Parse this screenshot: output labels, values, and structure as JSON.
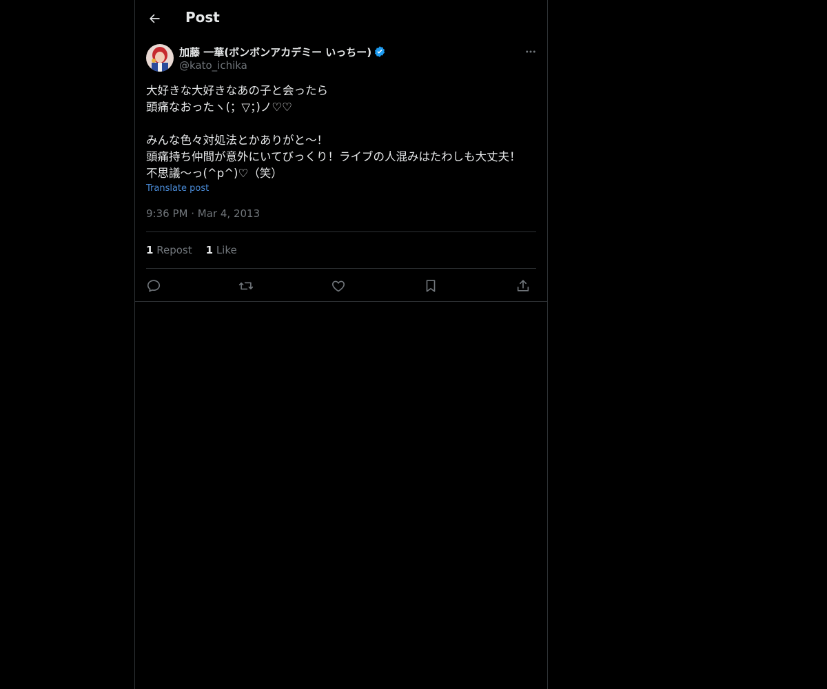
{
  "header": {
    "title": "Post",
    "back_icon": "arrow-left-icon"
  },
  "post": {
    "author": {
      "display_name": "加藤 一華(ボンボンアカデミー いっちー)",
      "handle": "@kato_ichika",
      "verified": true,
      "avatar_icon": "avatar"
    },
    "more_icon": "more-horizontal-icon",
    "text_lines": [
      "大好きな大好きなあの子と会ったら",
      "頭痛なおったヽ(；▽；)ノ♡♡",
      "",
      "みんな色々対処法とかありがと〜！",
      "頭痛持ち仲間が意外にいてびっくり！ライブの人混みはたわしも大丈夫！",
      "不思議〜っ(^p^)♡（笑）"
    ],
    "translate_label": "Translate post",
    "time": "9:36 PM",
    "separator": "·",
    "date": "Mar 4, 2013",
    "stats": {
      "reposts_count": "1",
      "reposts_label": "Repost",
      "likes_count": "1",
      "likes_label": "Like"
    },
    "actions": [
      "reply-icon",
      "repost-icon",
      "like-icon",
      "bookmark-icon",
      "share-icon"
    ]
  },
  "colors": {
    "background": "#000000",
    "text": "#e7e9ea",
    "muted": "#71767b",
    "link": "#4a8cd9",
    "verified": "#1d9bf0",
    "border": "#2f3336"
  }
}
